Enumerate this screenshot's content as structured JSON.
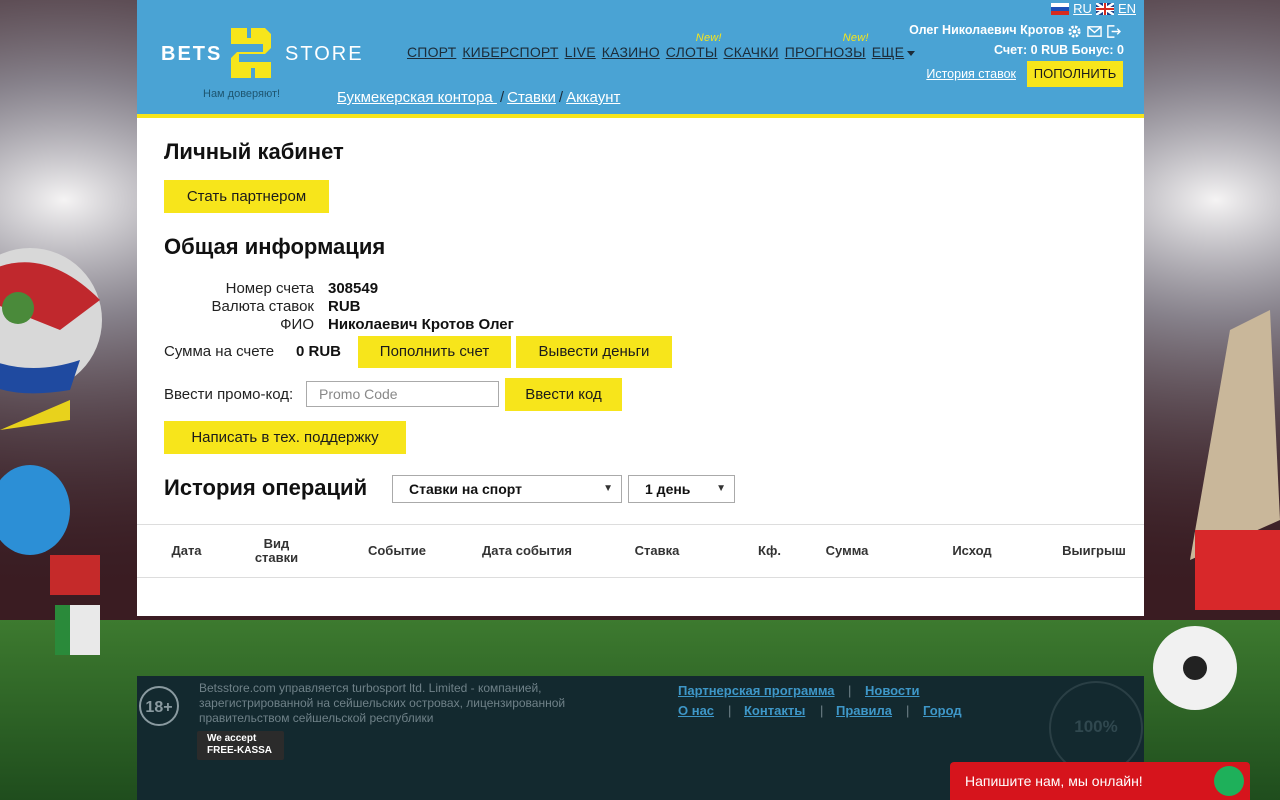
{
  "brand": {
    "bets": "BETS",
    "store": "STORE",
    "tagline": "Нам доверяют!",
    "colors": {
      "header": "#4aa3d4",
      "accent": "#f7e51b",
      "footer": "#13292f"
    }
  },
  "header": {
    "nav": [
      {
        "label": "СПОРТ"
      },
      {
        "label": "КИБЕРСПОРТ"
      },
      {
        "label": "LIVE"
      },
      {
        "label": "КАЗИНО"
      },
      {
        "label": "СЛОТЫ",
        "badge": "New!"
      },
      {
        "label": "СКАЧКИ"
      },
      {
        "label": "ПРОГНОЗЫ",
        "badge": "New!"
      },
      {
        "label": "ЕЩЕ"
      }
    ],
    "lang_ru": "RU",
    "lang_en": "EN",
    "user_name": "Олег Николаевич Кротов",
    "balance": "Счет: 0 RUB Бонус: 0",
    "history_link": "История ставок",
    "deposit_button": "ПОПОЛНИТЬ",
    "breadcrumb": [
      "Букмекерская контора ",
      "Ставки",
      "Аккаунт"
    ],
    "breadcrumb_sep": "/"
  },
  "account": {
    "title": "Личный кабинет",
    "partner_button": "Стать партнером",
    "info_title": "Общая информация",
    "account_number_label": "Номер счета",
    "account_number": "308549",
    "currency_label": "Валюта ставок",
    "currency": "RUB",
    "name_label": "ФИО",
    "name": "Николаевич Кротов Олег",
    "balance_label": "Сумма на счете",
    "balance": "0 RUB",
    "deposit_button": "Пополнить счет",
    "withdraw_button": "Вывести деньги",
    "promo_label": "Ввести промо-код:",
    "promo_placeholder": "Promo Code",
    "promo_button": "Ввести код",
    "support_button": "Написать в тех. поддержку"
  },
  "history": {
    "title": "История операций",
    "type_select": "Ставки на спорт",
    "period_select": "1 день",
    "columns": [
      "Дата",
      "Вид ставки",
      "Событие",
      "Дата события",
      "Ставка",
      "Кф.",
      "Сумма",
      "Исход",
      "Выигрыш"
    ]
  },
  "footer": {
    "age": "18+",
    "legal": "Betsstore.com управляется turbosport ltd. Limited - компанией, зарегистрированной на сейшельских островах, лицензированной правительством сейшельской республики",
    "accept_line1": "We accept",
    "accept_line2": "FREE-KASSA",
    "links_row1": [
      "Партнерская программа",
      "Новости"
    ],
    "links_row2": [
      "О нас",
      "Контакты",
      "Правила",
      "Город"
    ],
    "link_sep": "|",
    "cert": "100%"
  },
  "chat": {
    "label": "Напишите нам, мы онлайн!"
  }
}
